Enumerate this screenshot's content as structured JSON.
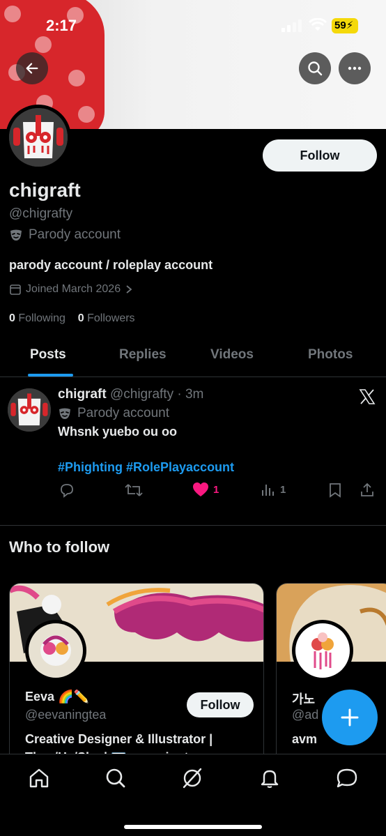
{
  "status_bar": {
    "time": "2:17",
    "battery": "59"
  },
  "profile": {
    "name": "chigraft",
    "handle": "@chigrafty",
    "label": "Parody account",
    "bio": "parody account / roleplay account",
    "joined": "Joined March 2026",
    "following_count": "0",
    "following_label": "Following",
    "followers_count": "0",
    "followers_label": "Followers",
    "follow_label": "Follow"
  },
  "tabs": [
    {
      "label": "Posts",
      "active": true
    },
    {
      "label": "Replies"
    },
    {
      "label": "Videos"
    },
    {
      "label": "Photos"
    }
  ],
  "post": {
    "name": "chigraft",
    "handle_time": "@chigrafty · 3m",
    "label": "Parody account",
    "text": "Whsnk yuebo ou oo",
    "tags": "#Phighting #RolePlayaccount",
    "likes": "1",
    "views": "1",
    "accent_like": "#f91880"
  },
  "who_to_follow": {
    "title": "Who to follow",
    "cards": [
      {
        "name": "Eeva 🌈✏️",
        "handle": "@eevaningtea",
        "bio": "Creative Designer & Illustrator | They/He/She | ✉️ eevaningtea",
        "follow_label": "Follow"
      },
      {
        "name": "가노",
        "handle": "@ad",
        "bio": "avm"
      }
    ]
  },
  "icons": [
    "back-arrow-icon",
    "search-icon",
    "more-icon",
    "calendar-icon",
    "chevron-right-icon",
    "mask-icon",
    "x-logo-icon",
    "reply-icon",
    "repost-icon",
    "heart-icon",
    "views-icon",
    "bookmark-icon",
    "share-icon",
    "plus-icon",
    "home-icon",
    "explore-icon",
    "grok-icon",
    "notifications-icon",
    "messages-icon"
  ],
  "colors": {
    "accent": "#1d9bf0",
    "background": "#000000",
    "muted": "#71767b"
  }
}
